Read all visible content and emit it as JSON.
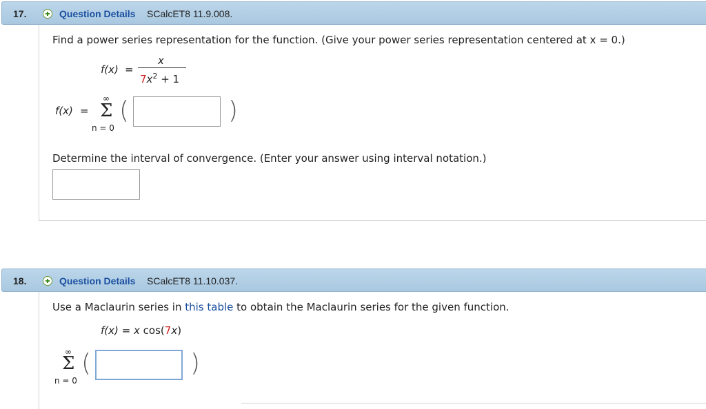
{
  "q17": {
    "number": "17.",
    "details_label": "Question Details",
    "ref": "SCalcET8 11.9.008.",
    "prompt": "Find a power series representation for the function. (Give your power series representation centered at x = 0.)",
    "fx_label": "f(x)",
    "equals": "=",
    "numerator": "x",
    "denom_coef": "7",
    "denom_var": "x",
    "denom_exp": "2",
    "denom_rest": " + 1",
    "sum_fx_label": "f(x)",
    "sum_equals": "=",
    "sum_upper": "∞",
    "sum_lower": "n = 0",
    "sigma": "Σ",
    "series_answer": "",
    "interval_prompt": "Determine the interval of convergence. (Enter your answer using interval notation.)",
    "interval_answer": ""
  },
  "q18": {
    "number": "18.",
    "details_label": "Question Details",
    "ref": "SCalcET8 11.10.037.",
    "prompt_before": "Use a Maclaurin series in ",
    "prompt_link": "this table",
    "prompt_after": " to obtain the Maclaurin series for the given function.",
    "fx_label": "f(x)",
    "equals": "=",
    "rhs_pre": "x cos(",
    "rhs_coef": "7",
    "rhs_var": "x",
    "rhs_post": ")",
    "sum_upper": "∞",
    "sum_lower": "n = 0",
    "sigma": "Σ",
    "series_answer": ""
  },
  "colors": {
    "header_bg": "#b3cfe5",
    "link_blue": "#1a4fa0",
    "accent_red": "#d02020",
    "plus_green": "#3d8b1f"
  },
  "icons": {
    "expand": "plus-circle-icon"
  }
}
